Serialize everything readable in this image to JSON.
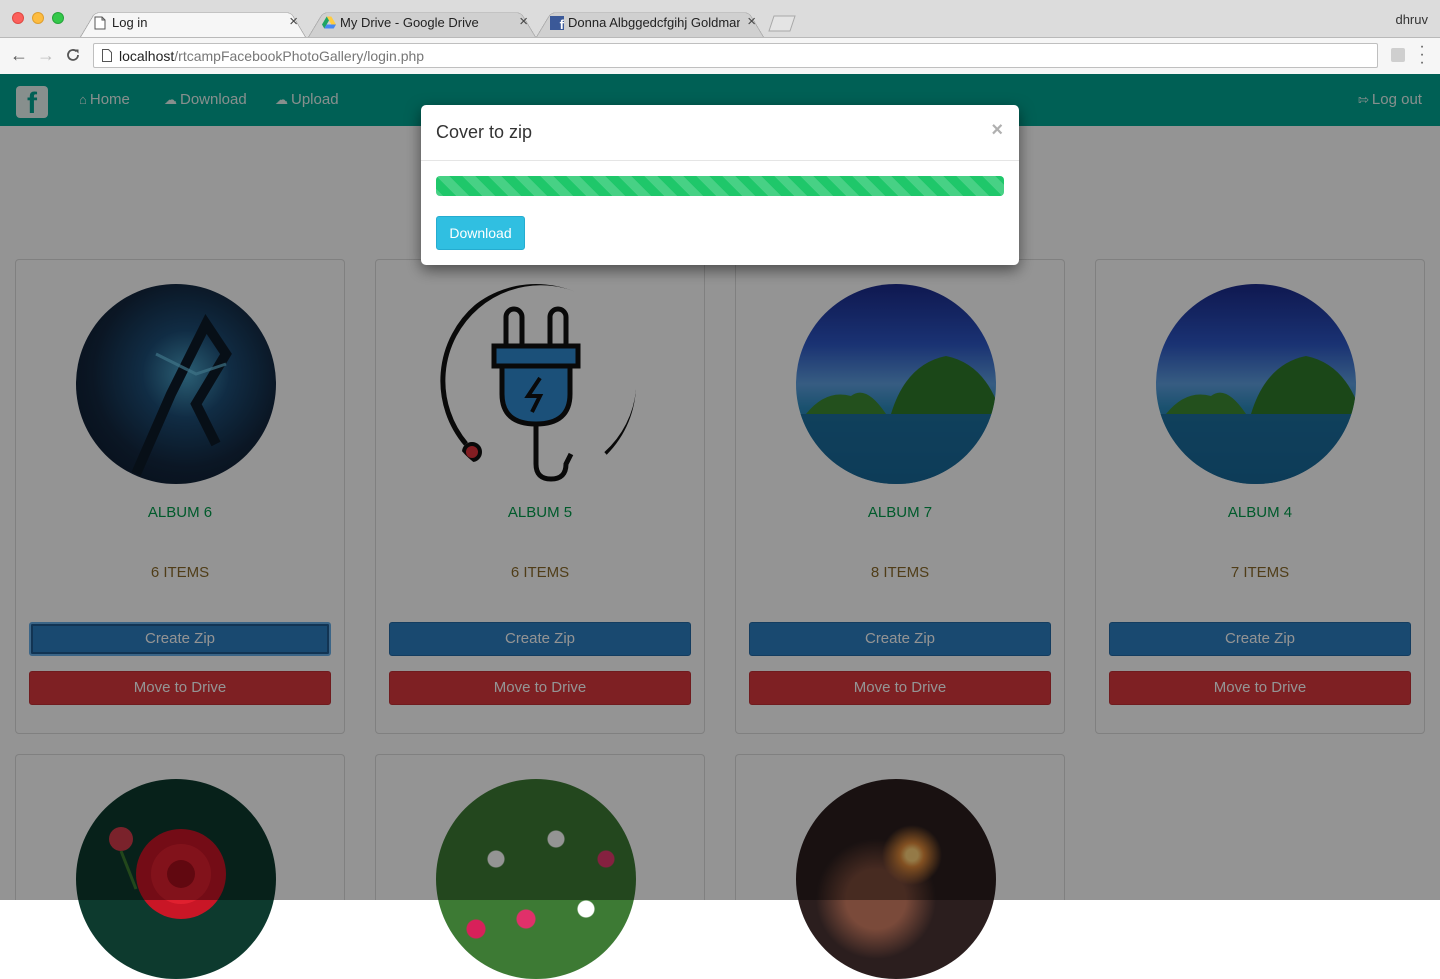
{
  "browser": {
    "tabs": [
      {
        "title": "Log in",
        "favicon": "page-icon",
        "active": true
      },
      {
        "title": "My Drive - Google Drive",
        "favicon": "google-drive-icon",
        "active": false
      },
      {
        "title": "Donna Albggedcfgihj Goldman",
        "favicon": "facebook-icon",
        "active": false
      }
    ],
    "profile_name": "dhruv",
    "url_host": "localhost",
    "url_path": "/rtcampFacebookPhotoGallery/login.php"
  },
  "navbar": {
    "brand_icon": "facebook-icon",
    "links": [
      {
        "label": "Home",
        "icon": "home-icon"
      },
      {
        "label": "Download",
        "icon": "cloud-download-icon"
      },
      {
        "label": "Upload",
        "icon": "cloud-upload-icon"
      }
    ],
    "logout": {
      "label": "Log out",
      "icon": "logout-icon"
    },
    "color": "#00a693"
  },
  "albums": [
    {
      "name": "ALBUM 6",
      "count": "6 ITEMS",
      "zip_label": "Create Zip",
      "drive_label": "Move to Drive",
      "image": "dragon-artwork"
    },
    {
      "name": "ALBUM 5",
      "count": "6 ITEMS",
      "zip_label": "Create Zip",
      "drive_label": "Move to Drive",
      "image": "plug-icon-artwork"
    },
    {
      "name": "ALBUM 7",
      "count": "8 ITEMS",
      "zip_label": "Create Zip",
      "drive_label": "Move to Drive",
      "image": "island-photo"
    },
    {
      "name": "ALBUM 4",
      "count": "7 ITEMS",
      "zip_label": "Create Zip",
      "drive_label": "Move to Drive",
      "image": "island-photo"
    },
    {
      "image": "red-flower-photo"
    },
    {
      "image": "daisy-field-photo"
    },
    {
      "image": "sparkler-photo"
    }
  ],
  "modal": {
    "title": "Cover to zip",
    "close_symbol": "×",
    "progress": 1.0,
    "download_label": "Download",
    "progress_color": "#1fc76a"
  }
}
